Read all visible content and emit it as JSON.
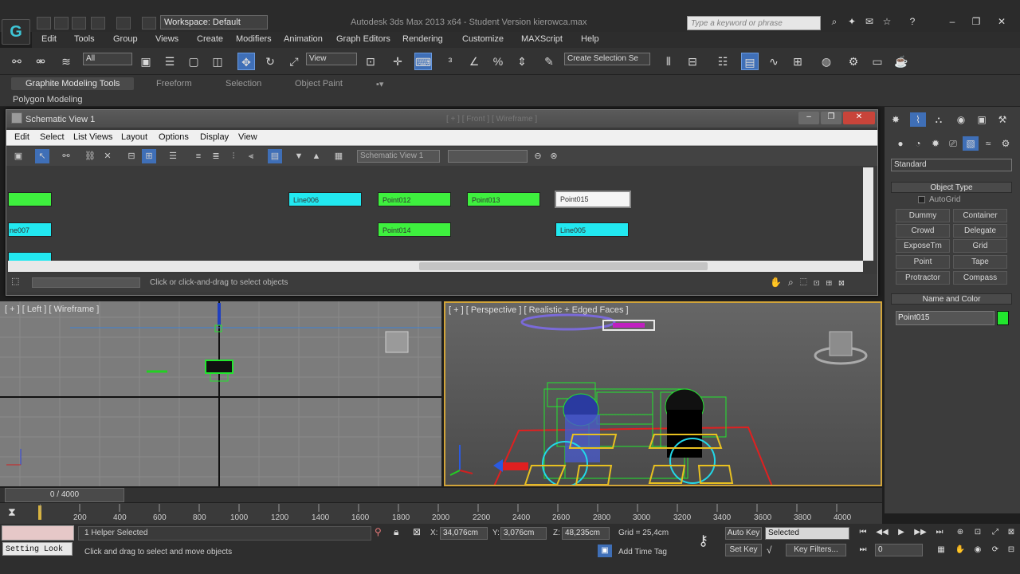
{
  "app": {
    "title": "Autodesk 3ds Max 2013 x64  -  Student Version    kierowca.max",
    "workspace": "Workspace: Default",
    "search_placeholder": "Type a keyword or phrase",
    "logo": "G"
  },
  "menu": [
    "Edit",
    "Tools",
    "Group",
    "Views",
    "Create",
    "Modifiers",
    "Animation",
    "Graph Editors",
    "Rendering",
    "Customize",
    "MAXScript",
    "Help"
  ],
  "toolbar": {
    "selection_filter": "All",
    "ref_coord": "View",
    "named_selection": "Create Selection Se"
  },
  "ribbon": {
    "tabs": [
      "Graphite Modeling Tools",
      "Freeform",
      "Selection",
      "Object Paint"
    ],
    "panel": "Polygon Modeling"
  },
  "schematic": {
    "title": "Schematic View 1",
    "behind_title": "[ + ] [ Front ] [ Wireframe ]",
    "menu": [
      "Edit",
      "Select",
      "List Views",
      "Layout",
      "Options",
      "Display",
      "View"
    ],
    "view_name": "Schematic View 1",
    "status": "Click or click-and-drag to select objects",
    "nodes": [
      {
        "label": "Line006",
        "color": "cyan"
      },
      {
        "label": "Point012",
        "color": "green"
      },
      {
        "label": "Point013",
        "color": "green"
      },
      {
        "label": "Point015",
        "color": "white"
      },
      {
        "label": "ne007",
        "color": "cyan"
      },
      {
        "label": "Point014",
        "color": "green"
      },
      {
        "label": "Line005",
        "color": "cyan"
      }
    ]
  },
  "viewports": {
    "left": "[ + ] [ Left ] [ Wireframe ]",
    "perspective": "[ + ] [ Perspective ] [ Realistic + Edged Faces ]"
  },
  "command_panel": {
    "category": "Standard",
    "object_type_title": "Object Type",
    "autogrid": "AutoGrid",
    "buttons": [
      "Dummy",
      "Container",
      "Crowd",
      "Delegate",
      "ExposeTm",
      "Grid",
      "Point",
      "Tape",
      "Protractor",
      "Compass"
    ],
    "name_color_title": "Name and Color",
    "object_name": "Point015",
    "object_color": "#22e62e"
  },
  "timeline": {
    "frame": "0 / 4000",
    "ticks": [
      "200",
      "400",
      "600",
      "800",
      "1000",
      "1200",
      "1400",
      "1600",
      "1800",
      "2000",
      "2200",
      "2400",
      "2600",
      "2800",
      "3000",
      "3200",
      "3400",
      "3600",
      "3800",
      "4000"
    ]
  },
  "status": {
    "maxscript_label": "Setting Look",
    "selected": "1 Helper Selected",
    "prompt": "Click and drag to select and move objects",
    "x_label": "X:",
    "x": "34,076cm",
    "y_label": "Y:",
    "y": "3,076cm",
    "z_label": "Z:",
    "z": "48,235cm",
    "grid": "Grid = 25,4cm",
    "add_time_tag": "Add Time Tag",
    "auto_key": "Auto Key",
    "auto_key_value": "Selected",
    "set_key": "Set Key",
    "key_filters": "Key Filters...",
    "frame_field": "0"
  }
}
